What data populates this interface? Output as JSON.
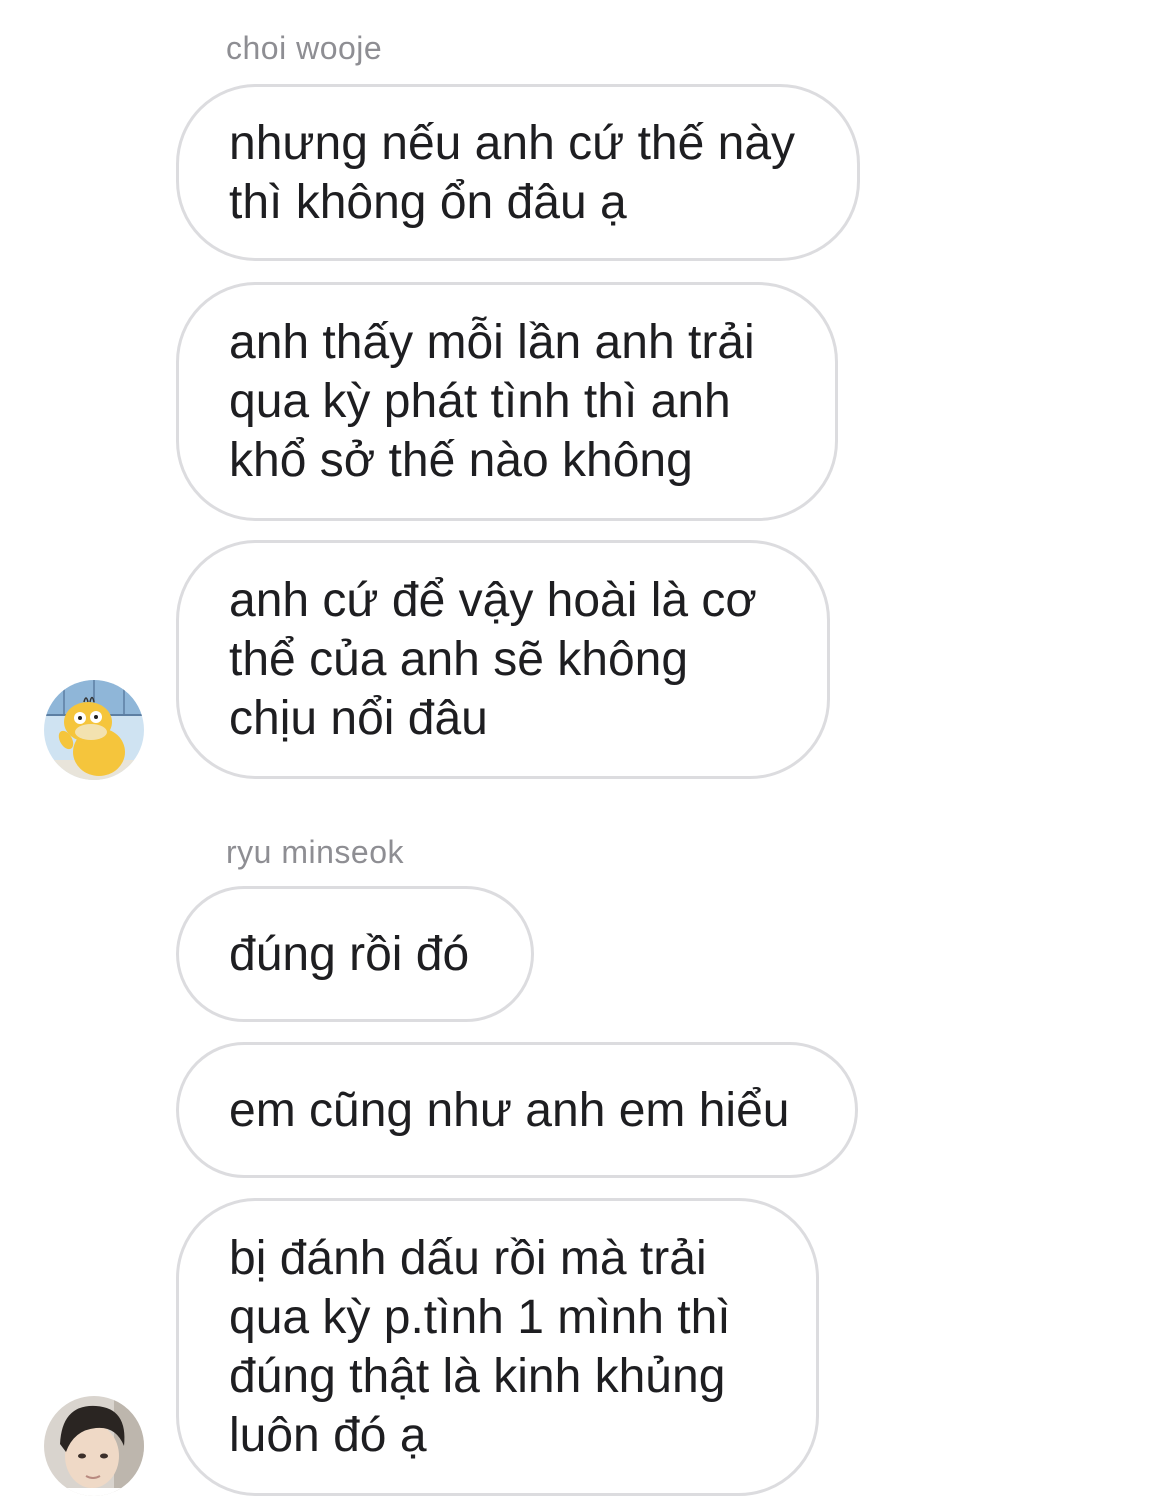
{
  "groups": [
    {
      "sender": "choi wooje",
      "avatar_icon": "psyduck-avatar-icon",
      "messages": [
        "nhưng nếu anh cứ thế này\nthì không ổn đâu ạ",
        "anh thấy mỗi lần anh trải\nqua kỳ phát tình thì anh\nkhổ sở thế nào không",
        "anh cứ để vậy hoài là cơ\nthể của anh sẽ không\nchịu nổi đâu"
      ]
    },
    {
      "sender": "ryu minseok",
      "avatar_icon": "person-photo-avatar-icon",
      "messages": [
        "đúng rồi đó",
        "em cũng như anh em hiểu",
        "bị đánh dấu rồi mà trải\nqua kỳ p.tình 1 mình thì\nđúng thật là kinh khủng\nluôn đó ạ"
      ]
    }
  ],
  "colors": {
    "bubble_border": "#dcdcdf",
    "sender_name": "#8e8e93",
    "text": "#1e1e21",
    "background": "#ffffff"
  }
}
